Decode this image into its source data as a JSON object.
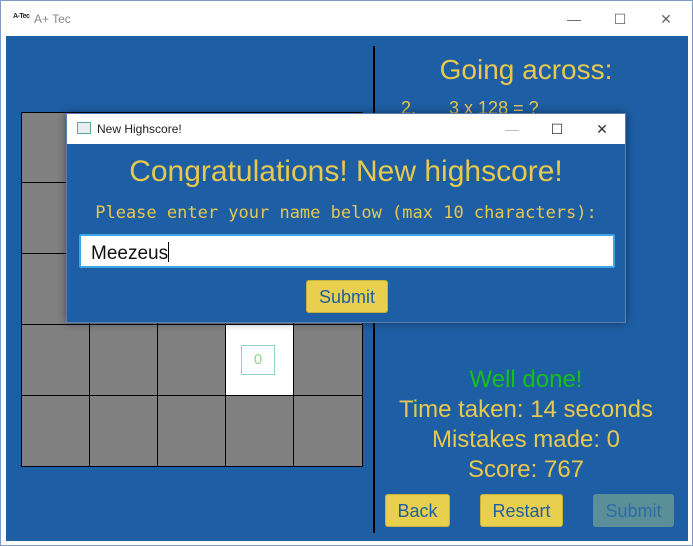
{
  "window": {
    "title": "A+ Tec",
    "icon_text": "A-Tec"
  },
  "left_panel": {
    "revealed_cell_value": "0"
  },
  "right_panel": {
    "heading": "Going across:",
    "clue_number": "2.",
    "clue_text": "3 x 128 =  ?",
    "well_done": "Well done!",
    "time_taken": "Time taken: 14 seconds",
    "mistakes": "Mistakes made: 0",
    "score": "Score: 767",
    "back_label": "Back",
    "restart_label": "Restart",
    "submit_label": "Submit"
  },
  "dialog": {
    "title": "New Highscore!",
    "congrats": "Congratulations! New highscore!",
    "prompt": "Please enter your name below (max 10 characters):",
    "name_value": "Meezeus",
    "submit_label": "Submit"
  },
  "colors": {
    "background": "#1d5ea4",
    "text_yellow": "#e8c84d",
    "success_green": "#17c017",
    "button": "#e8d04e"
  }
}
